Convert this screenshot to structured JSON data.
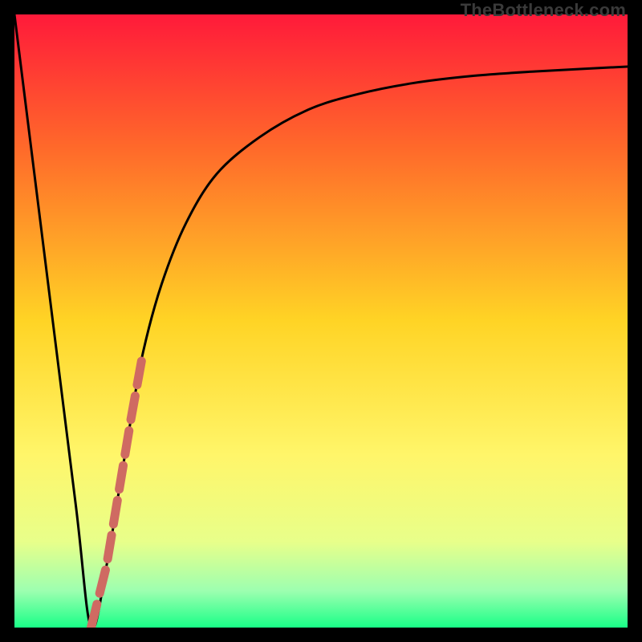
{
  "watermark": "TheBottleneck.com",
  "colors": {
    "frame_bg": "#000000",
    "gradient_top": "#ff1a3a",
    "gradient_mid1": "#ff6a2a",
    "gradient_mid2": "#ffd425",
    "gradient_mid3": "#fff66a",
    "gradient_low1": "#e8ff8a",
    "gradient_low2": "#9dffb0",
    "gradient_bottom": "#19ff87",
    "curve": "#000000",
    "dash": "#cf6a62"
  },
  "chart_data": {
    "type": "line",
    "title": "",
    "xlabel": "",
    "ylabel": "",
    "xlim": [
      0,
      100
    ],
    "ylim": [
      0,
      100
    ],
    "series": [
      {
        "name": "bottleneck-curve",
        "x": [
          0,
          5,
          10,
          12.5,
          15,
          17,
          19,
          21,
          24,
          28,
          33,
          40,
          48,
          56,
          65,
          75,
          85,
          100
        ],
        "y": [
          100,
          60,
          20,
          0,
          10,
          22,
          34,
          45,
          56,
          66,
          74,
          80,
          84.5,
          87,
          88.8,
          90,
          90.7,
          91.5
        ]
      }
    ],
    "highlight_segment": {
      "name": "dashed-accent",
      "x_range": [
        12.5,
        21
      ],
      "y_range": [
        0,
        45
      ]
    },
    "background_gradient_stops": [
      {
        "pos": 0.0,
        "color": "#ff1a3a"
      },
      {
        "pos": 0.2,
        "color": "#ff5030"
      },
      {
        "pos": 0.45,
        "color": "#ffb020"
      },
      {
        "pos": 0.62,
        "color": "#ffe040"
      },
      {
        "pos": 0.78,
        "color": "#fbff70"
      },
      {
        "pos": 0.88,
        "color": "#d8ff90"
      },
      {
        "pos": 0.94,
        "color": "#8affb0"
      },
      {
        "pos": 1.0,
        "color": "#19ff87"
      }
    ]
  }
}
